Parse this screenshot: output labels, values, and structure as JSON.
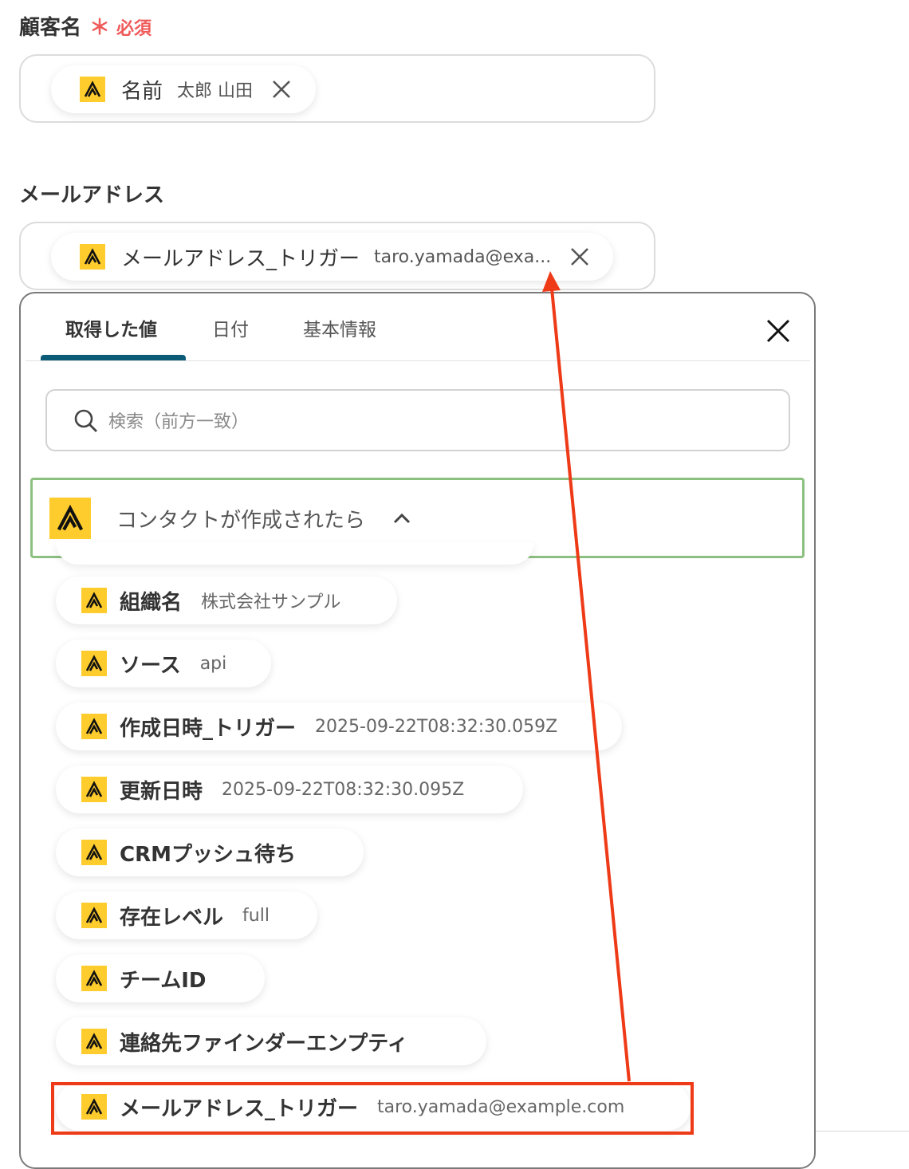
{
  "customer_name": {
    "label": "顧客名",
    "required_mark": "＊",
    "required_text": "必須",
    "pill_key": "名前",
    "pill_value": "太郎 山田"
  },
  "email": {
    "label": "メールアドレス",
    "pill_key": "メールアドレス_トリガー",
    "pill_value": "taro.yamada@exa..."
  },
  "panel": {
    "tabs": [
      "取得した値",
      "日付",
      "基本情報"
    ],
    "active_tab": 0,
    "search_placeholder": "検索（前方一致）",
    "group_title": "コンタクトが作成されたら",
    "items": [
      {
        "key": "組織名",
        "value": "株式会社サンプル"
      },
      {
        "key": "ソース",
        "value": "api"
      },
      {
        "key": "作成日時_トリガー",
        "value": "2025-09-22T08:32:30.059Z"
      },
      {
        "key": "更新日時",
        "value": "2025-09-22T08:32:30.095Z"
      },
      {
        "key": "CRMプッシュ待ち",
        "value": ""
      },
      {
        "key": "存在レベル",
        "value": "full"
      },
      {
        "key": "チームID",
        "value": ""
      },
      {
        "key": "連絡先ファインダーエンプティ",
        "value": ""
      },
      {
        "key": "メールアドレス_トリガー",
        "value": "taro.yamada@example.com"
      }
    ]
  },
  "colors": {
    "accent_tab": "#0b5a77",
    "group_border": "#8cc080",
    "annotation": "#ee3a17",
    "logo_bg": "#ffcc2e",
    "required": "#ef5a5a"
  }
}
